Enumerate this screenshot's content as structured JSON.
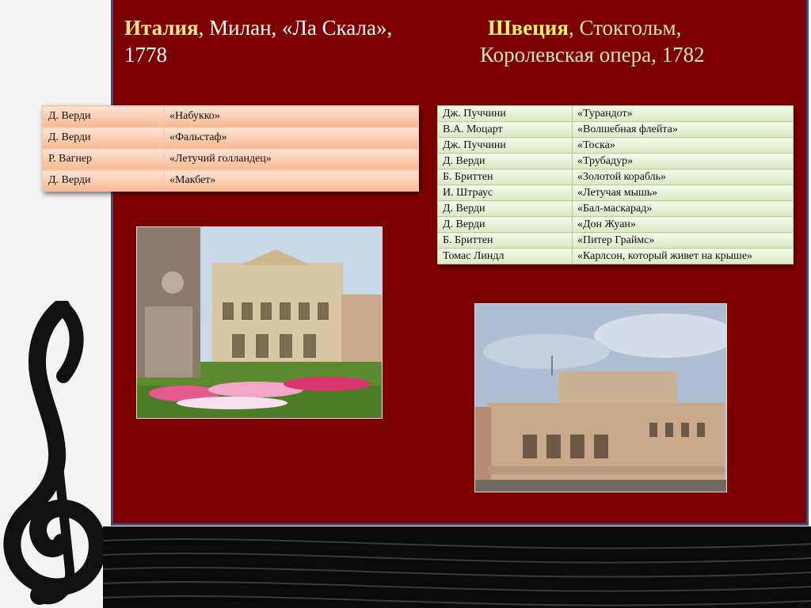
{
  "title_left": {
    "country": "Италия",
    "rest": ", Милан, «Ла Скала»,",
    "year": "1778"
  },
  "title_right": {
    "country": "Швеция",
    "rest": ", Стокгольм,",
    "line2": "Королевская опера, 1782"
  },
  "italy_table": [
    {
      "composer": "Д. Верди",
      "opera": "«Набукко»"
    },
    {
      "composer": "Д. Верди",
      "opera": "«Фальстаф»"
    },
    {
      "composer": "Р. Вагнер",
      "opera": "«Летучий голландец»"
    },
    {
      "composer": "Д. Верди",
      "opera": "«Макбет»"
    }
  ],
  "sweden_table": [
    {
      "composer": "Дж. Пуччини",
      "opera": "«Турандот»"
    },
    {
      "composer": "В.А. Моцарт",
      "opera": "«Волшебная флейта»"
    },
    {
      "composer": "Дж. Пуччини",
      "opera": "«Тоска»"
    },
    {
      "composer": "Д. Верди",
      "opera": "«Трубадур»"
    },
    {
      "composer": "Б. Бриттен",
      "opera": "«Золотой корабль»"
    },
    {
      "composer": "И. Штраус",
      "opera": "«Летучая мышь»"
    },
    {
      "composer": "Д. Верди",
      "opera": "«Бал-маскарад»"
    },
    {
      "composer": "Д. Верди",
      "opera": "«Дон Жуан»"
    },
    {
      "composer": "Б. Бриттен",
      "opera": "«Питер Граймс»"
    },
    {
      "composer": "Томас Линдл",
      "opera": "«Карлсон, который живет на крыше»"
    }
  ],
  "colors": {
    "panel": "#7d0000",
    "panel_border": "#3d4f7a",
    "italy_country": "#ffe98a",
    "sweden_country": "#f4f46a",
    "sweden_text": "#d2e6a8"
  },
  "icons": {
    "clef": "treble-clef-icon"
  }
}
